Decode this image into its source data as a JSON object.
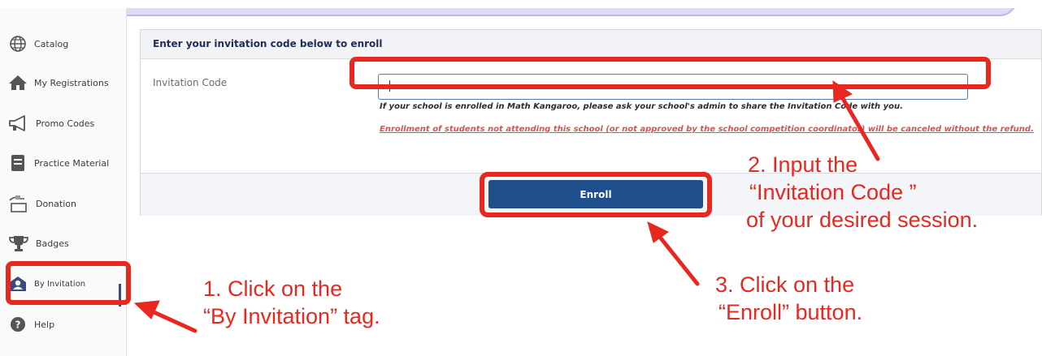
{
  "sidebar": {
    "items": [
      {
        "label": "Catalog",
        "icon": "globe-icon"
      },
      {
        "label": "My Registrations",
        "icon": "home-icon"
      },
      {
        "label": "Promo Codes",
        "icon": "megaphone-icon"
      },
      {
        "label": "Practice Material",
        "icon": "book-icon"
      },
      {
        "label": "Donation",
        "icon": "donation-icon"
      },
      {
        "label": "Badges",
        "icon": "trophy-icon"
      },
      {
        "label": "By Invitation",
        "icon": "envelope-icon",
        "active": true
      },
      {
        "label": "Help",
        "icon": "help-icon"
      }
    ]
  },
  "enroll_form": {
    "title": "Enter your invitation code below to enroll",
    "field_label": "Invitation Code",
    "input_value": "",
    "hint": "If your school is enrolled in Math Kangaroo, please ask your school's admin to share the Invitation Code with you.",
    "warning": "Enrollment of students not attending this school (or not approved by the school competition coordinator) will be canceled without the refund.",
    "enroll_label": "Enroll"
  },
  "annotations": {
    "step1_line1": "1. Click on the",
    "step1_line2": "“By Invitation” tag.",
    "step2_line1": "2. Input the",
    "step2_line2": "“Invitation Code ”",
    "step2_line3": "of your desired session.",
    "step3_line1": "3. Click on the",
    "step3_line2": "“Enroll” button."
  },
  "colors": {
    "annotation_red": "#e8271f",
    "primary_blue": "#1f4e8c",
    "title_navy": "#1f2d5a",
    "warning_red": "#d9534f",
    "top_bar_lavender": "#dcdcf6"
  }
}
